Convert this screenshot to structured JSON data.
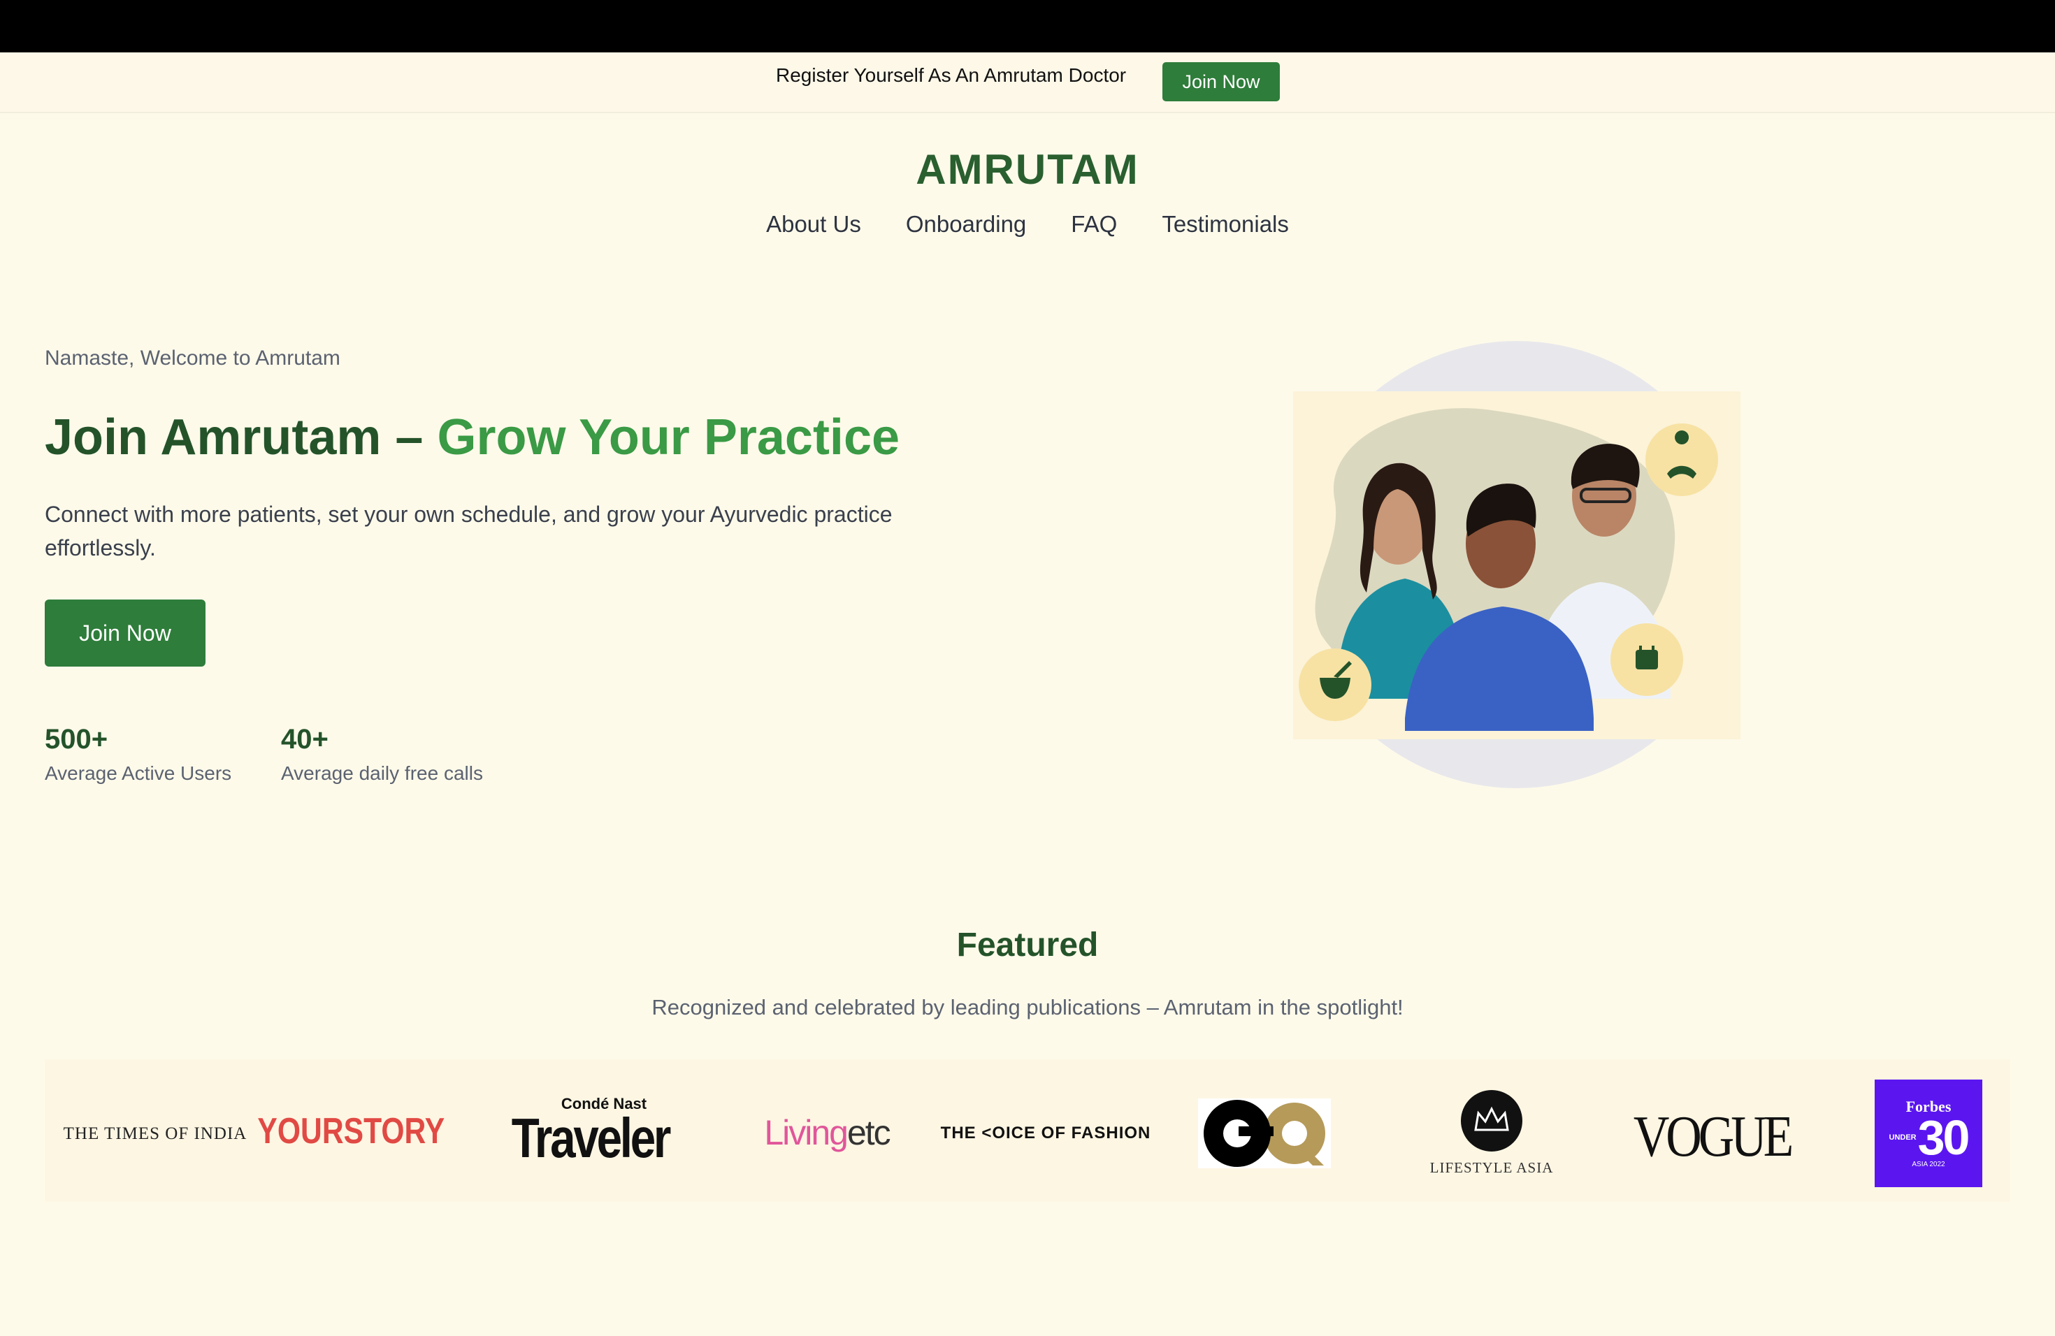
{
  "announcement": {
    "text": "Register Yourself As An Amrutam Doctor",
    "button_label": "Join Now"
  },
  "brand": {
    "name": "AMRUTAM"
  },
  "nav": {
    "items": [
      {
        "label": "About Us"
      },
      {
        "label": "Onboarding"
      },
      {
        "label": "FAQ"
      },
      {
        "label": "Testimonials"
      }
    ]
  },
  "hero": {
    "greeting": "Namaste, Welcome to Amrutam",
    "title_main": "Join Amrutam – ",
    "title_accent": "Grow Your Practice",
    "description": "Connect with more patients, set your own schedule, and grow your Ayurvedic practice effortlessly.",
    "cta_label": "Join Now",
    "stats": [
      {
        "value": "500+",
        "label": "Average Active Users"
      },
      {
        "value": "40+",
        "label": "Average daily free calls"
      }
    ],
    "badges": [
      "meditation-icon",
      "mortar-pestle-icon",
      "calendar-icon"
    ]
  },
  "featured": {
    "title": "Featured",
    "subtitle": "Recognized and celebrated by leading publications – Amrutam in the spotlight!",
    "logos": {
      "times_of_india": "THE TIMES OF INDIA",
      "yourstory": "YOURSTORY",
      "traveler_top": "Condé Nast",
      "traveler_main": "Traveler",
      "livingetc_a": "Living",
      "livingetc_b": "etc",
      "voice_of_fashion": "THE <OICE OF FASHION",
      "gq": "GQ",
      "lifestyle_asia": "LIFESTYLE ASIA",
      "vogue": "VOGUE",
      "forbes_top": "Forbes",
      "forbes_under": "UNDER",
      "forbes_num": "30",
      "forbes_bottom": "ASIA 2022"
    }
  },
  "colors": {
    "background": "#fefaea",
    "primary_green": "#2e7d3a",
    "dark_green": "#24532a",
    "accent_green": "#3a9a45",
    "badge_yellow": "#f7e2a4",
    "forbes_purple": "#5b16f0",
    "yourstory_red": "#e14a44",
    "living_pink": "#e0569a",
    "gq_gold": "#b59a5a"
  }
}
